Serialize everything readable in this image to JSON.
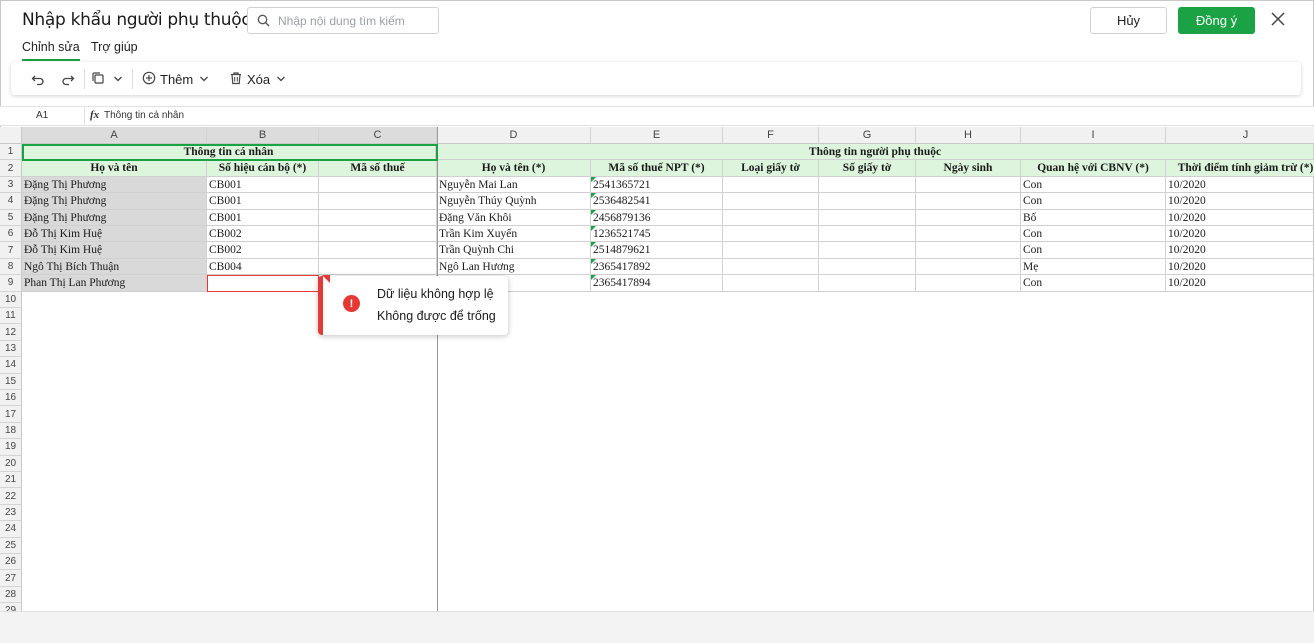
{
  "window": {
    "title": "Nhập khẩu người phụ thuộc",
    "search_placeholder": "Nhập nội dung tìm kiếm",
    "cancel_label": "Hủy",
    "ok_label": "Đồng ý"
  },
  "tabs": [
    {
      "label": "Chỉnh sửa"
    },
    {
      "label": "Trợ giúp"
    }
  ],
  "toolbar": {
    "add_label": "Thêm",
    "delete_label": "Xóa"
  },
  "formula_bar": {
    "cell_ref": "A1",
    "fx": "fx",
    "value": "Thông tin cá nhân"
  },
  "columns": [
    "A",
    "B",
    "C",
    "D",
    "E",
    "F",
    "G",
    "H",
    "I",
    "J"
  ],
  "row_numbers": [
    "1",
    "2",
    "3",
    "4",
    "5",
    "6",
    "7",
    "8",
    "9",
    "10",
    "11",
    "12",
    "13",
    "14",
    "15",
    "16",
    "17",
    "18",
    "19",
    "20",
    "21",
    "22",
    "23",
    "24",
    "25",
    "26",
    "27",
    "28",
    "29"
  ],
  "sheet": {
    "group_personal": "Thông tin cá nhân",
    "group_dependent": "Thông tin người phụ thuộc",
    "headers": [
      "Họ và tên",
      "Số hiệu cán bộ (*)",
      "Mã số thuế",
      "Họ và tên (*)",
      "Mã số thuế NPT (*)",
      "Loại giấy tờ",
      "Số giấy tờ",
      "Ngày sinh",
      "Quan hệ với CBNV (*)",
      "Thời điểm tính giảm trừ (*)"
    ],
    "rows": [
      [
        "Đặng Thị Phương",
        "CB001",
        "",
        "Nguyễn Mai Lan",
        "2541365721",
        "",
        "",
        "",
        "Con",
        "10/2020"
      ],
      [
        "Đặng Thị Phương",
        "CB001",
        "",
        "Nguyễn Thúy Quỳnh",
        "2536482541",
        "",
        "",
        "",
        "Con",
        "10/2020"
      ],
      [
        "Đặng Thị Phương",
        "CB001",
        "",
        "Đặng Văn Khôi",
        "2456879136",
        "",
        "",
        "",
        "Bố",
        "10/2020"
      ],
      [
        "Đỗ Thị Kim Huệ",
        "CB002",
        "",
        "Trần Kim Xuyến",
        "1236521745",
        "",
        "",
        "",
        "Con",
        "10/2020"
      ],
      [
        "Đỗ Thị Kim Huệ",
        "CB002",
        "",
        "Trần Quỳnh Chi",
        "2514879621",
        "",
        "",
        "",
        "Con",
        "10/2020"
      ],
      [
        "Ngô Thị Bích Thuận",
        "CB004",
        "",
        "Ngô Lan Hương",
        "2365417892",
        "",
        "",
        "",
        "Mẹ",
        "10/2020"
      ],
      [
        "Phan Thị Lan Phương",
        "",
        "",
        "nh",
        "2365417894",
        "",
        "",
        "",
        "Con",
        "10/2020"
      ]
    ]
  },
  "error_popup": {
    "title": "Dữ liệu không hợp lệ",
    "message": "Không được để trống",
    "icon_text": "!"
  },
  "colors": {
    "accent": "#1aa244",
    "header_fill": "#ddf5dd",
    "error": "#e53935"
  }
}
